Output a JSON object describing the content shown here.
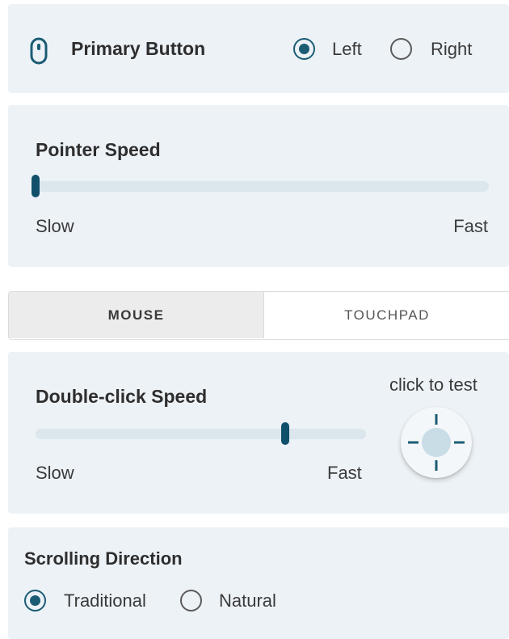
{
  "primary_button": {
    "title": "Primary Button",
    "options": [
      {
        "label": "Left",
        "selected": true
      },
      {
        "label": "Right",
        "selected": false
      }
    ]
  },
  "pointer_speed": {
    "title": "Pointer Speed",
    "min_label": "Slow",
    "max_label": "Fast",
    "value_fraction": 0.0
  },
  "device_tabs": {
    "tabs": [
      {
        "label": "MOUSE",
        "active": true
      },
      {
        "label": "TOUCHPAD",
        "active": false
      }
    ]
  },
  "double_click_speed": {
    "title": "Double-click Speed",
    "min_label": "Slow",
    "max_label": "Fast",
    "value_fraction": 0.75,
    "test_label": "click to test"
  },
  "scrolling_direction": {
    "title": "Scrolling Direction",
    "options": [
      {
        "label": "Traditional",
        "selected": true
      },
      {
        "label": "Natural",
        "selected": false
      }
    ]
  },
  "colors": {
    "accent": "#1b5c74",
    "card_background": "#edf2f7",
    "slider_track": "#dbe6ed",
    "slider_thumb": "#11506a"
  },
  "icons": [
    "mouse-icon",
    "crosshair-icon"
  ]
}
